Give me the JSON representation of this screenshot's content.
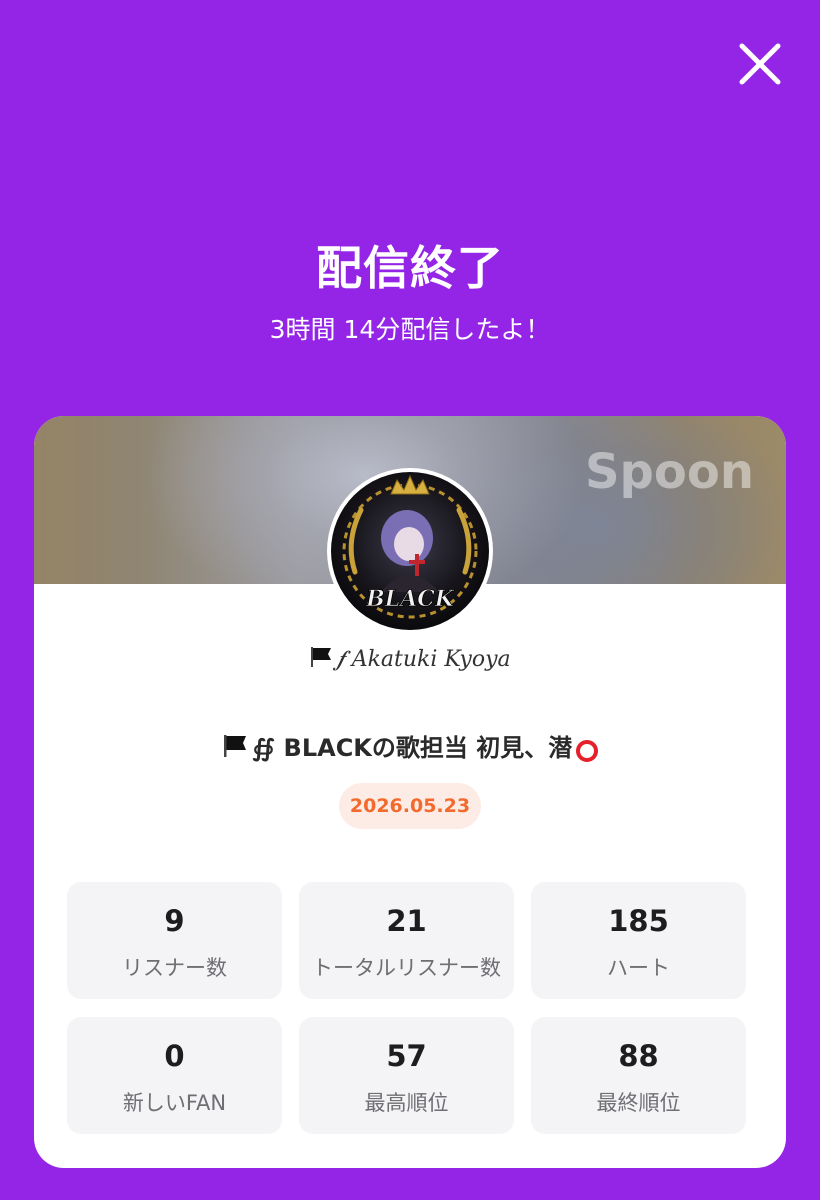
{
  "header": {
    "close_icon": "close-icon",
    "title": "配信終了",
    "subtitle": "3時間 14分配信したよ！"
  },
  "card": {
    "brand": "Spoon",
    "avatar_text": "BLACK",
    "user_name": "Akatuki Kyoya",
    "user_prefix": "𝆑",
    "live_title": "BLACKの歌担当 初見、潜",
    "live_title_prefix": "∯",
    "date": "2026.05.23",
    "colors": {
      "accent": "#9425e6",
      "date_text": "#f26a2d",
      "date_bg": "#fdece6",
      "stat_bg": "#f4f4f6"
    }
  },
  "stats": [
    {
      "value": "9",
      "label": "リスナー数"
    },
    {
      "value": "21",
      "label": "トータルリスナー数"
    },
    {
      "value": "185",
      "label": "ハート"
    },
    {
      "value": "0",
      "label": "新しいFAN"
    },
    {
      "value": "57",
      "label": "最高順位"
    },
    {
      "value": "88",
      "label": "最終順位"
    }
  ]
}
